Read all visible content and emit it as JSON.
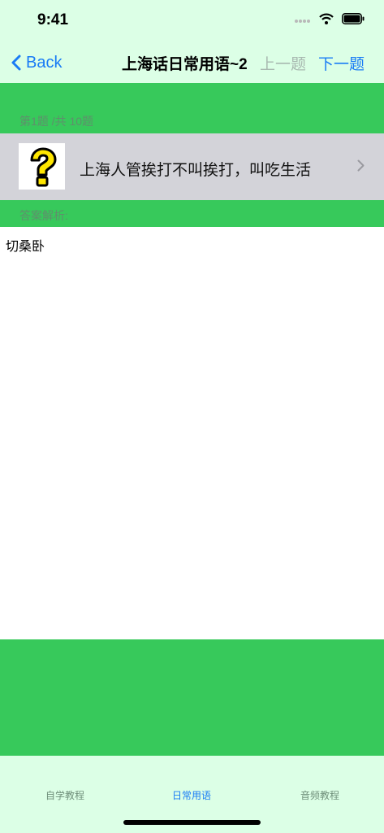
{
  "status_bar": {
    "time": "9:41"
  },
  "nav": {
    "back_label": "Back",
    "title": "上海话日常用语~2",
    "prev_label": "上一题",
    "next_label": "下一题"
  },
  "question": {
    "count_label": "第1题 /共 10题",
    "text": "上海人管挨打不叫挨打，叫吃生活"
  },
  "answer": {
    "label": "答案解析:",
    "text": "切桑卧"
  },
  "tabs": [
    {
      "label": "自学教程"
    },
    {
      "label": "日常用语",
      "active": true
    },
    {
      "label": "音频教程"
    }
  ],
  "colors": {
    "accent": "#1a7cf5",
    "green": "#37c95b",
    "light_green": "#dcffe6"
  }
}
